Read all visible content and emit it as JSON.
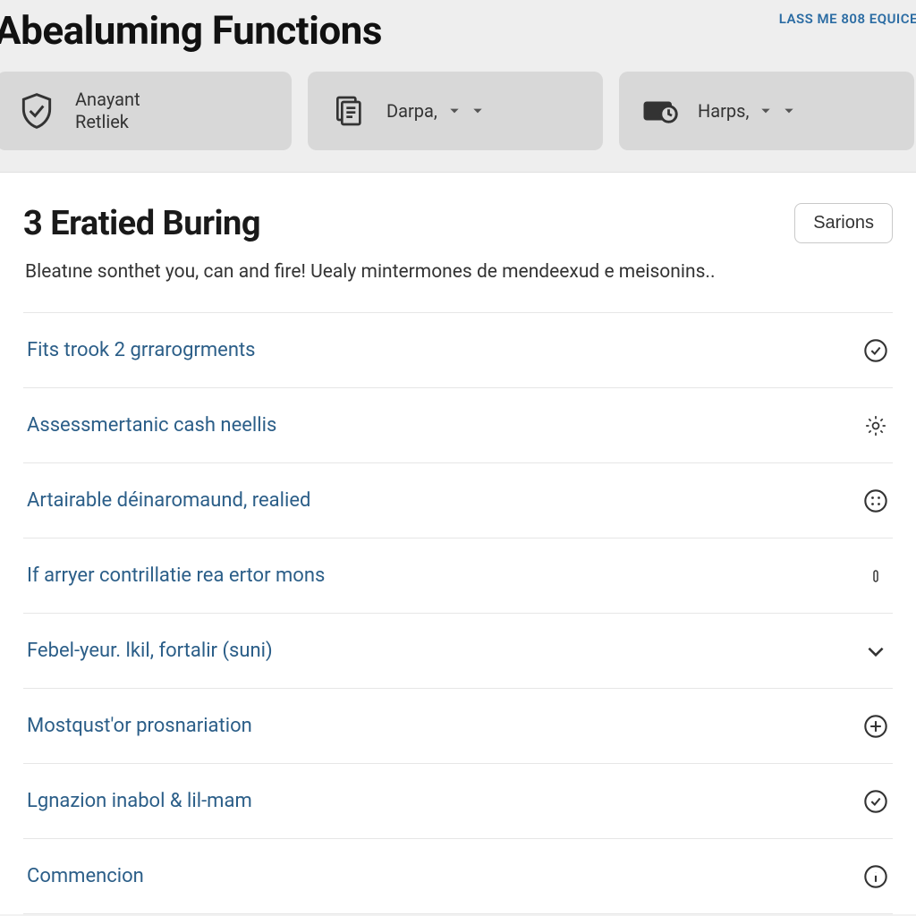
{
  "header": {
    "title": "Abealuming Functions",
    "link": "LASS ME 808 EQUICE",
    "pills": [
      {
        "line1": "Anayant",
        "line2": "Retliek",
        "icon": "shield-check-icon",
        "has_caret": false
      },
      {
        "line1": "Darpa,",
        "line2": "",
        "icon": "documents-icon",
        "has_caret": true
      },
      {
        "line1": "Harps,",
        "line2": "",
        "icon": "card-clock-icon",
        "has_caret": true
      }
    ]
  },
  "section": {
    "title": "3 Eratied Buring",
    "button": "Sarions",
    "description": "Bleatıne sonthet you, can and fire! Uealy mintermones de mendeexud e meisonins..",
    "rows": [
      {
        "label": "Fits trook 2 grrarogrments",
        "icon": "check-circle-icon"
      },
      {
        "label": "Assessmertanic cash neellis",
        "icon": "gear-icon"
      },
      {
        "label": "Artairable déinaromaund, realied",
        "icon": "dots-circle-icon"
      },
      {
        "label": "If arryer contrillatie rea ertor mons",
        "icon": "pill-icon"
      },
      {
        "label": "Febel-yeur. lkil, fortalir (suni)",
        "icon": "chevron-down-icon"
      },
      {
        "label": "Mostqust'or prosnariation",
        "icon": "plus-circle-icon"
      },
      {
        "label": "Lgnazion inabol & lil-mam",
        "icon": "check-circle-icon"
      },
      {
        "label": "Commencion",
        "icon": "info-circle-icon"
      }
    ]
  }
}
